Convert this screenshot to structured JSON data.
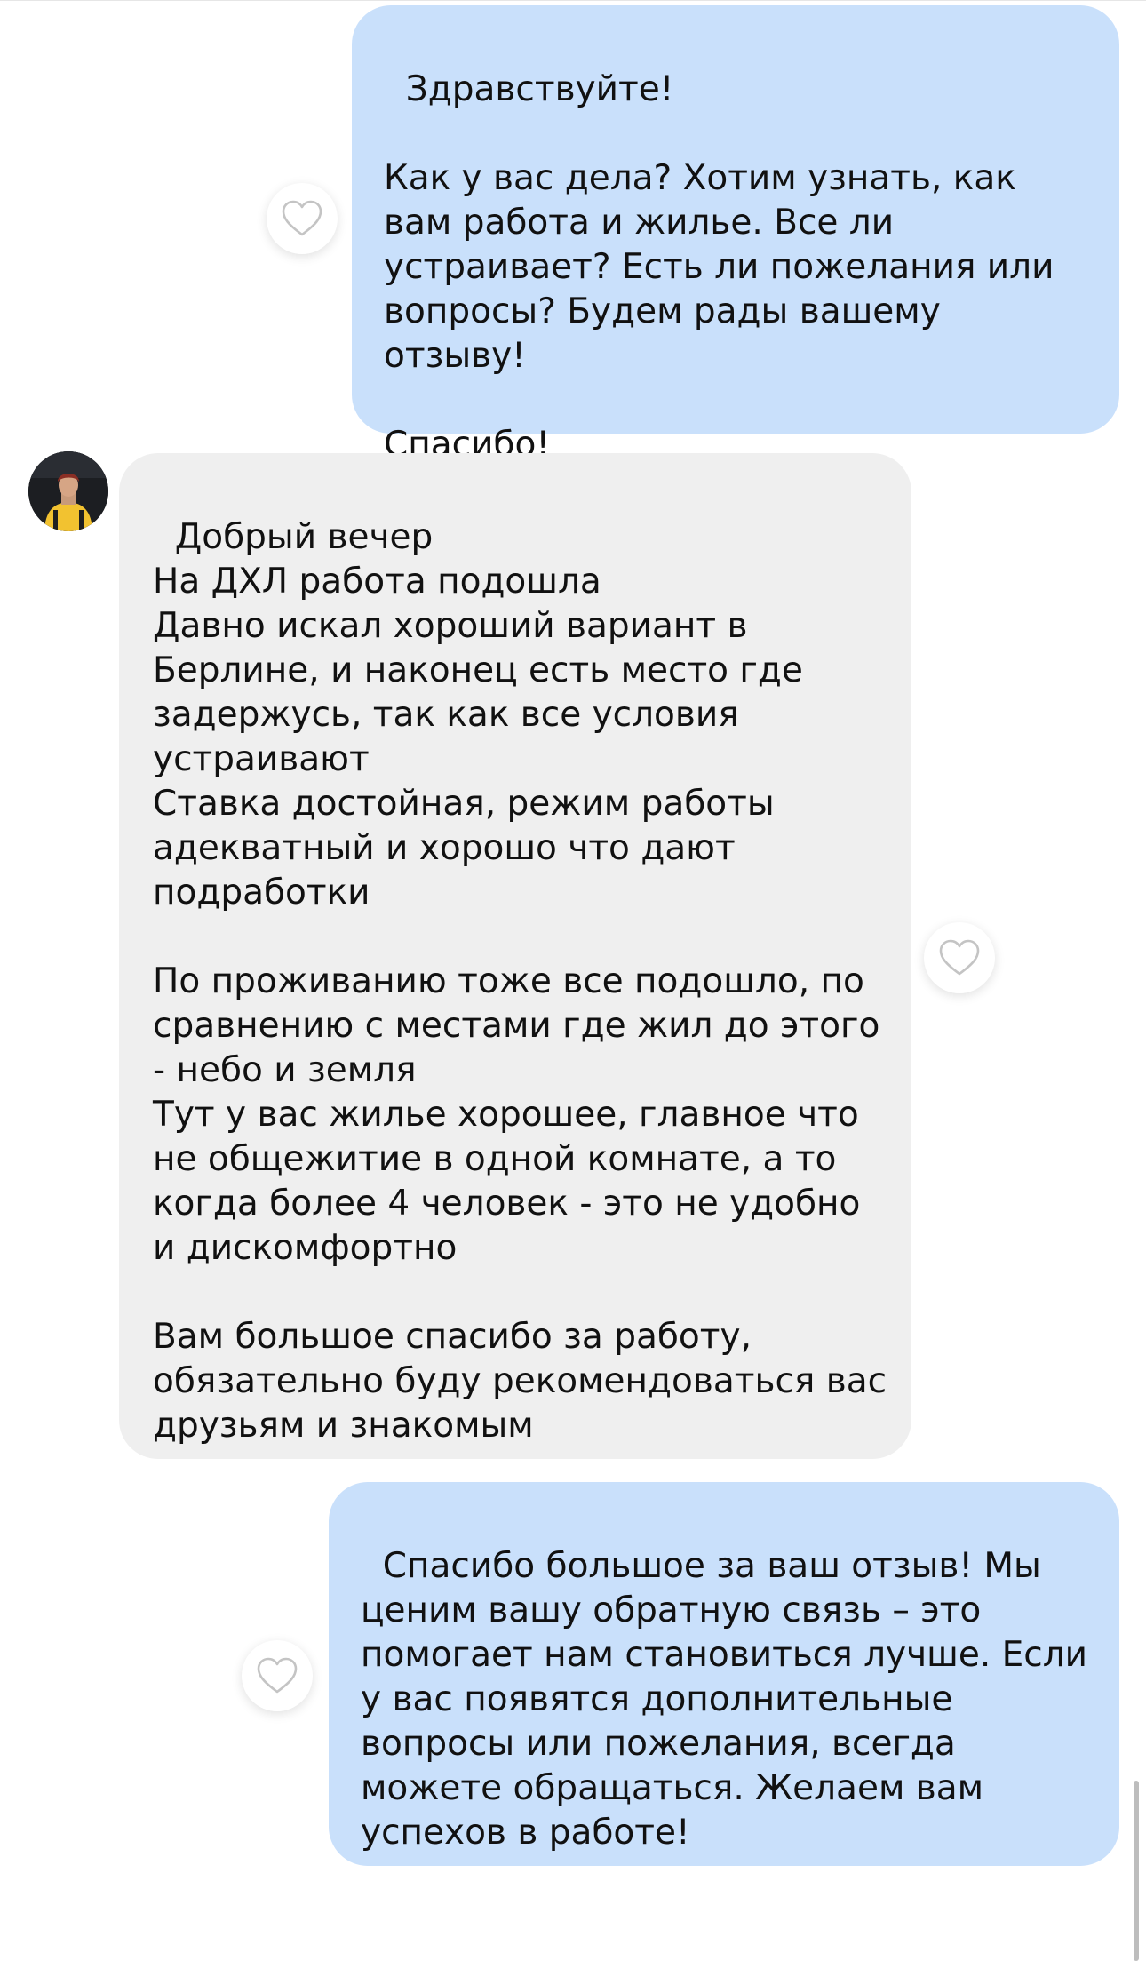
{
  "messages": [
    {
      "direction": "outgoing",
      "text": "Здравствуйте!\n\nКак у вас дела? Хотим узнать, как вам работа и жилье. Все ли устраивает? Есть ли пожелания или вопросы? Будем рады вашему отзыву!\n\nСпасибо!"
    },
    {
      "direction": "incoming",
      "text": "Добрый вечер\nНа ДХЛ работа подошла\nДавно искал хороший вариант в Берлине, и наконец есть место где задержусь, так как все условия устраивают\nСтавка достойная, режим работы адекватный и хорошо что дают подработки\n\nПо проживанию тоже все подошло, по сравнению с местами где жил до этого - небо и земля\nТут у вас жилье хорошее, главное что не общежитие в одной комнате, а то когда более 4 человек - это не удобно и дискомфортно\n\nВам большое спасибо за работу, обязательно буду рекомендоваться вас друзьям и знакомым"
    },
    {
      "direction": "outgoing",
      "text": "Спасибо большое за ваш отзыв! Мы ценим вашу обратную связь – это помогает нам становиться лучше. Если у вас появятся дополнительные вопросы или пожелания, всегда можете обращаться. Желаем вам успехов в работе!"
    }
  ],
  "icons": {
    "like": "heart-outline-icon",
    "avatar": "user-avatar"
  },
  "colors": {
    "outgoing_bubble": "#c9e0fb",
    "incoming_bubble": "#efefef",
    "text": "#111111",
    "heart_outline": "#c4c4c4"
  }
}
